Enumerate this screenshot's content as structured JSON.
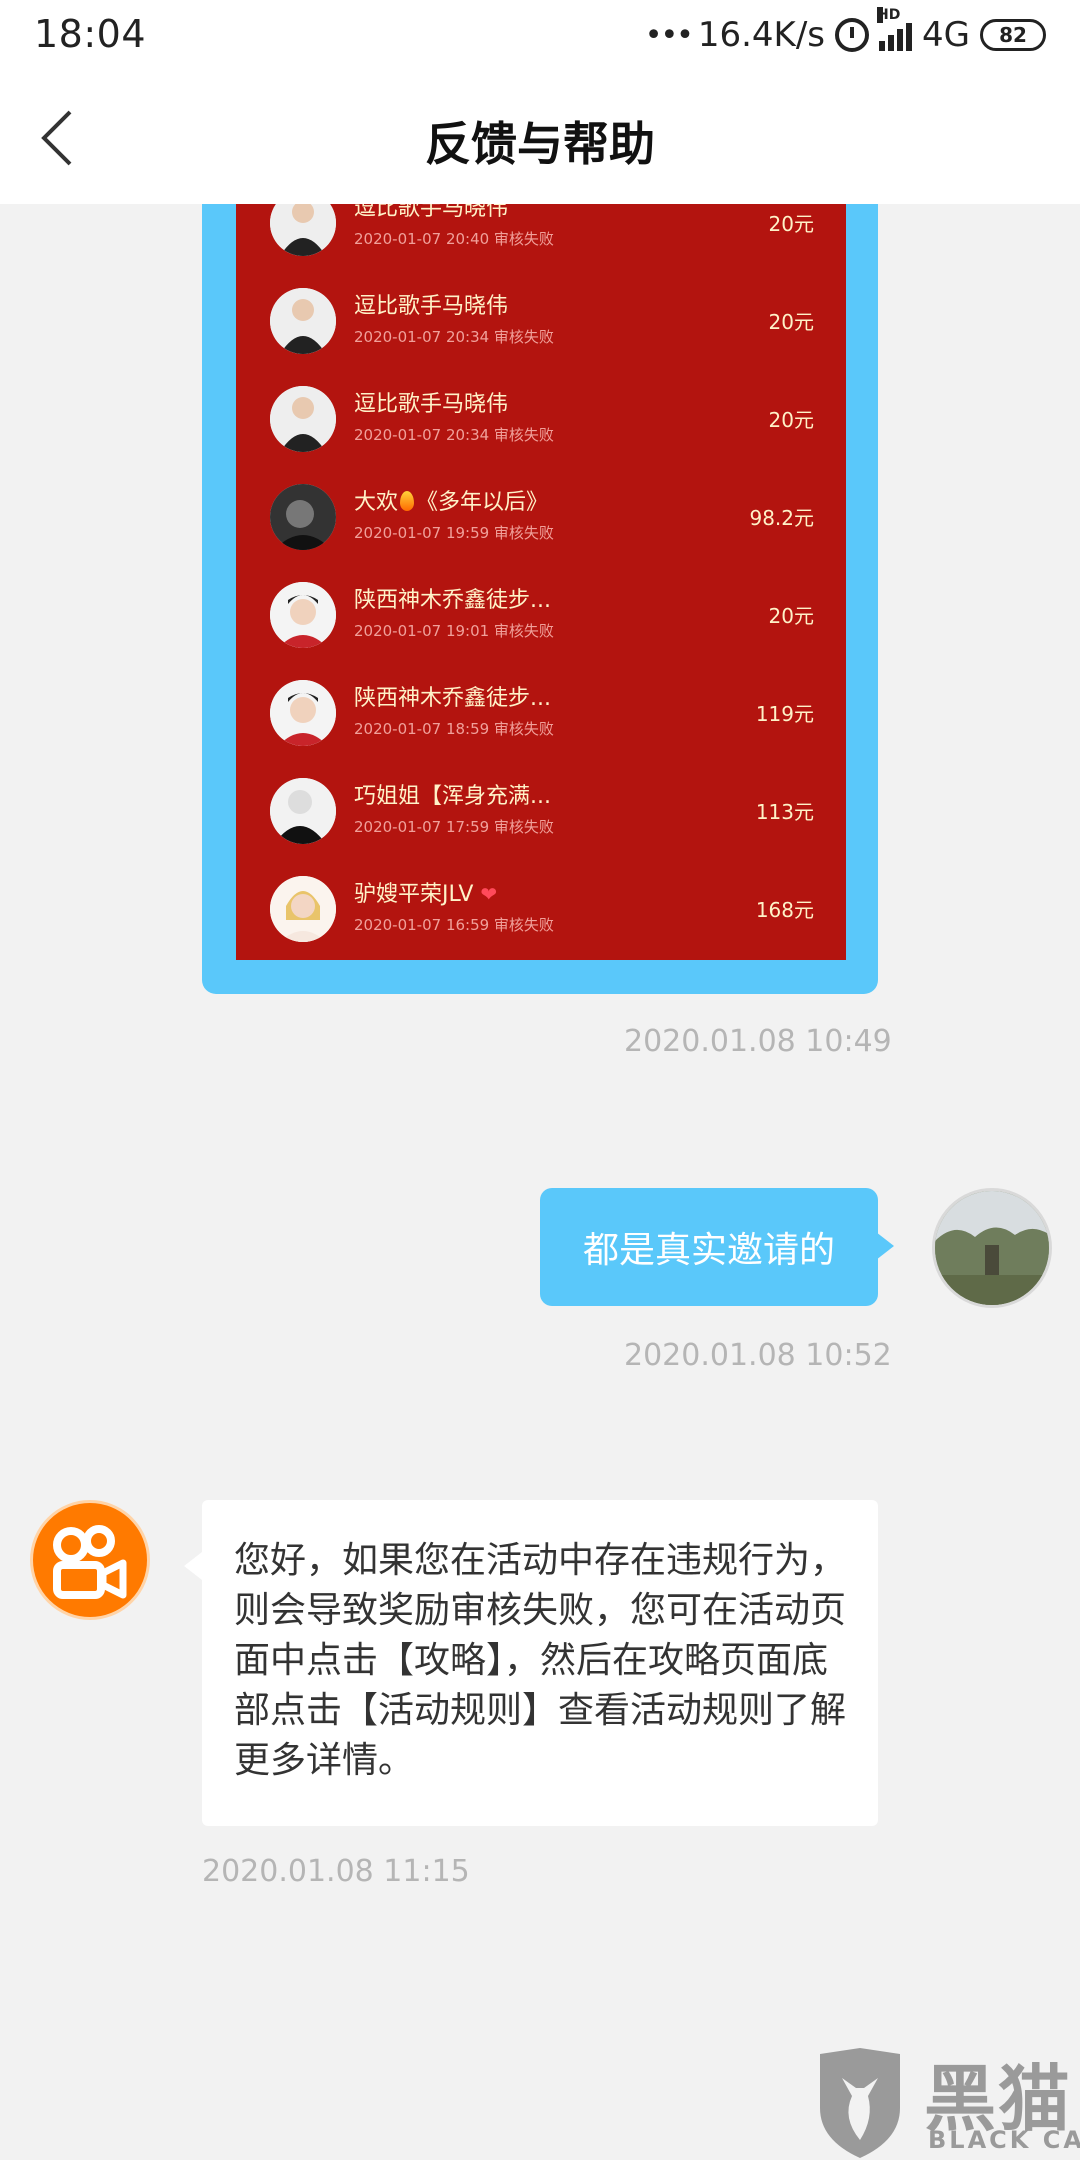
{
  "status_bar": {
    "time": "18:04",
    "speed": "16.4K/s",
    "hd": "HD",
    "network": "4G",
    "battery": "82"
  },
  "nav": {
    "title": "反馈与帮助"
  },
  "records": [
    {
      "name": "逗比歌手马晓伟",
      "meta": "2020-01-07 20:40 审核失败",
      "amount": "20元"
    },
    {
      "name": "逗比歌手马晓伟",
      "meta": "2020-01-07 20:34 审核失败",
      "amount": "20元"
    },
    {
      "name": "逗比歌手马晓伟",
      "meta": "2020-01-07 20:34 审核失败",
      "amount": "20元"
    },
    {
      "name_pre": "大欢",
      "name_post": "《多年以后》",
      "meta": "2020-01-07 19:59 审核失败",
      "amount": "98.2元"
    },
    {
      "name": "陕西神木乔鑫徒步...",
      "meta": "2020-01-07 19:01 审核失败",
      "amount": "20元"
    },
    {
      "name": "陕西神木乔鑫徒步...",
      "meta": "2020-01-07 18:59 审核失败",
      "amount": "119元"
    },
    {
      "name": "巧姐姐【浑身充满...",
      "meta": "2020-01-07 17:59 审核失败",
      "amount": "113元"
    },
    {
      "name": "驴嫂平荣JLV",
      "name_suffix": "❤",
      "meta": "2020-01-07 16:59 审核失败",
      "amount": "168元"
    }
  ],
  "messages": {
    "ts1": "2020.01.08 10:49",
    "out_text": "都是真实邀请的",
    "ts2": "2020.01.08 10:52",
    "in_text": "您好，如果您在活动中存在违规行为，则会导致奖励审核失败，您可在活动页面中点击【攻略】，然后在攻略页面底部点击【活动规则】查看活动规则了解更多详情。",
    "ts3": "2020.01.08 11:15"
  },
  "watermark": {
    "cn": "黑猫",
    "en": "BLACK CAT"
  },
  "colors": {
    "accent_blue": "#5ac8fa",
    "panel_red": "#b3140f",
    "brand_orange": "#ff7a00"
  }
}
